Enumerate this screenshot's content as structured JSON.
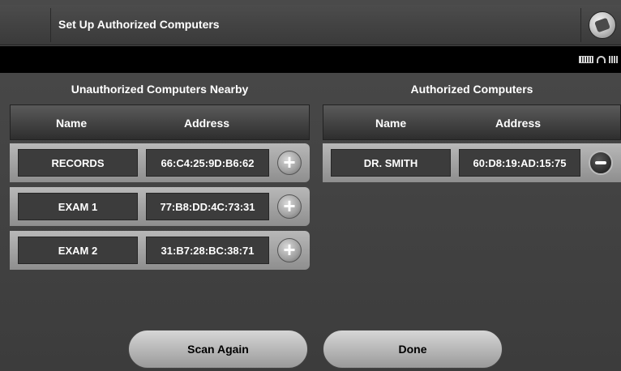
{
  "header": {
    "title": "Set Up Authorized Computers",
    "menu_icon": "device-menu-icon"
  },
  "status": {
    "icons": [
      "battery-icon",
      "wifi-icon",
      "signal-icon"
    ]
  },
  "unauthorized": {
    "heading": "Unauthorized Computers Nearby",
    "columns": {
      "name": "Name",
      "address": "Address"
    },
    "rows": [
      {
        "name": "RECORDS",
        "address": "66:C4:25:9D:B6:62",
        "action": "+"
      },
      {
        "name": "EXAM 1",
        "address": "77:B8:DD:4C:73:31",
        "action": "+"
      },
      {
        "name": "EXAM 2",
        "address": "31:B7:28:BC:38:71",
        "action": "+"
      }
    ]
  },
  "authorized": {
    "heading": "Authorized Computers",
    "columns": {
      "name": "Name",
      "address": "Address"
    },
    "rows": [
      {
        "name": "DR. SMITH",
        "address": "60:D8:19:AD:15:75",
        "action": "−"
      }
    ]
  },
  "buttons": {
    "scan_again": "Scan Again",
    "done": "Done"
  },
  "colors": {
    "background": "#444444",
    "row": "#a8a8a8",
    "cell": "#3c3c3c",
    "text": "#ffffff"
  }
}
